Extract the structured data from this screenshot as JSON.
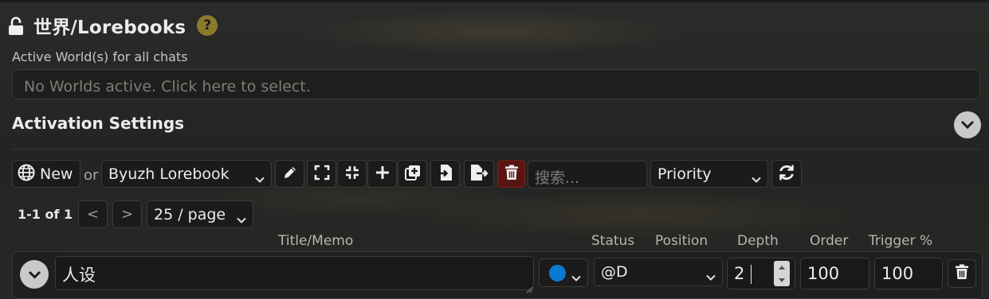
{
  "header": {
    "title": "世界/Lorebooks",
    "help": "?"
  },
  "active_worlds": {
    "label": "Active World(s) for all chats",
    "placeholder": "No Worlds active. Click here to select."
  },
  "activation": {
    "label": "Activation Settings"
  },
  "toolbar": {
    "new_label": "New",
    "or_label": "or",
    "lorebook_selected": "Byuzh Lorebook",
    "search_placeholder": "搜索...",
    "sort_selected": "Priority",
    "icons": [
      "globe-icon",
      "pencil-icon",
      "expand-icon",
      "collapse-icon",
      "plus-icon",
      "duplicate-icon",
      "import-icon",
      "export-icon",
      "trash-icon",
      "refresh-icon"
    ],
    "delete_color": "#5a1414"
  },
  "pager": {
    "count": "1-1 of 1",
    "prev": "<",
    "next": ">",
    "per_page": "25 / page"
  },
  "columns": {
    "title_memo": "Title/Memo",
    "status": "Status",
    "position": "Position",
    "depth": "Depth",
    "order": "Order",
    "trigger": "Trigger %"
  },
  "entry": {
    "memo": "人设",
    "status_color": "#0a7ad1",
    "position": "@D",
    "depth": "2",
    "order": "100",
    "trigger": "100"
  }
}
